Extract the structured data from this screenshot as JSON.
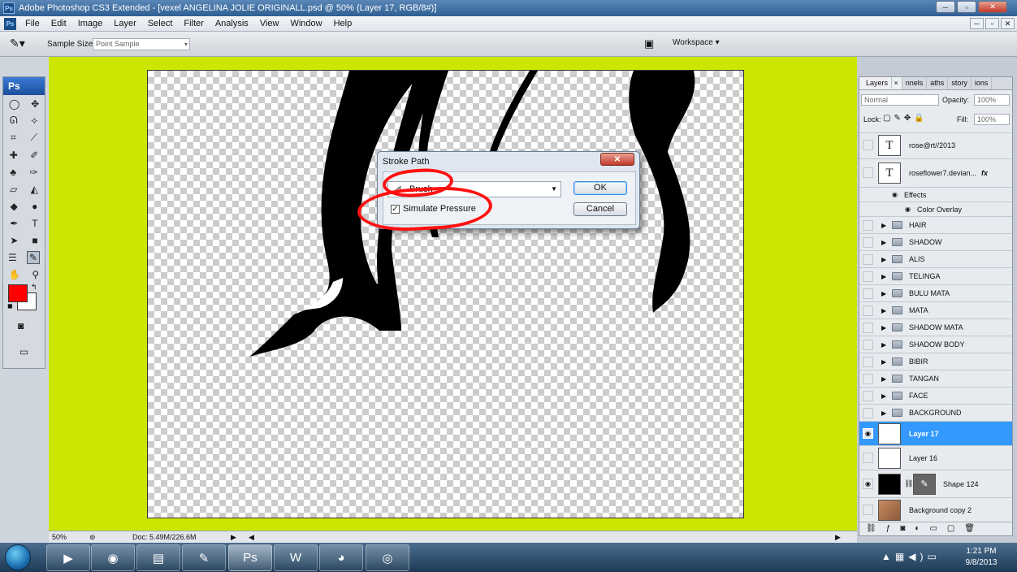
{
  "window": {
    "title": "Adobe Photoshop CS3 Extended - [vexel ANGELINA JOLIE ORIGINALL.psd @ 50% (Layer 17, RGB/8#)]",
    "app_icon": "Ps"
  },
  "menu": [
    "File",
    "Edit",
    "Image",
    "Layer",
    "Select",
    "Filter",
    "Analysis",
    "View",
    "Window",
    "Help"
  ],
  "options": {
    "sample_size_label": "Sample Size:",
    "sample_size_value": "Point Sample",
    "workspace_label": "Workspace"
  },
  "toolbox": {
    "logo": "Ps",
    "fg_color": "#ff0000",
    "bg_color": "#ffffff"
  },
  "dialog": {
    "title": "Stroke Path",
    "tool_value": "Brush",
    "simulate_pressure_label": "Simulate Pressure",
    "simulate_pressure_checked": true,
    "ok_label": "OK",
    "cancel_label": "Cancel",
    "annotation_color": "#ff1010"
  },
  "status": {
    "zoom": "50%",
    "doc": "Doc: 5.49M/226.6M"
  },
  "layers_panel": {
    "tabs": [
      "Layers",
      "nnels",
      "aths",
      "story",
      "ions"
    ],
    "blend_mode": "Normal",
    "opacity_label": "Opacity:",
    "opacity": "100%",
    "lock_label": "Lock:",
    "fill_label": "Fill:",
    "fill": "100%",
    "effects_label": "Effects",
    "color_overlay_label": "Color Overlay",
    "layers": [
      {
        "name": "rose@rt//2013",
        "type": "text"
      },
      {
        "name": "roseflower7.devian...",
        "type": "text",
        "fx": "fx"
      },
      {
        "name": "HAIR",
        "type": "group"
      },
      {
        "name": "SHADOW",
        "type": "group"
      },
      {
        "name": "ALIS",
        "type": "group"
      },
      {
        "name": "TELINGA",
        "type": "group"
      },
      {
        "name": "BULU MATA",
        "type": "group"
      },
      {
        "name": "MATA",
        "type": "group"
      },
      {
        "name": "SHADOW MATA",
        "type": "group"
      },
      {
        "name": "SHADOW BODY",
        "type": "group"
      },
      {
        "name": "BIBIR",
        "type": "group"
      },
      {
        "name": "TANGAN",
        "type": "group"
      },
      {
        "name": "FACE",
        "type": "group"
      },
      {
        "name": "BACKGROUND",
        "type": "group"
      },
      {
        "name": "Layer 17",
        "type": "layer",
        "selected": true
      },
      {
        "name": "Layer 16",
        "type": "layer"
      },
      {
        "name": "Shape 124",
        "type": "shape"
      },
      {
        "name": "Background copy 2",
        "type": "photo"
      }
    ]
  },
  "taskbar": {
    "time": "1:21 PM",
    "date": "9/8/2013"
  },
  "workspace_color": "#cce600"
}
